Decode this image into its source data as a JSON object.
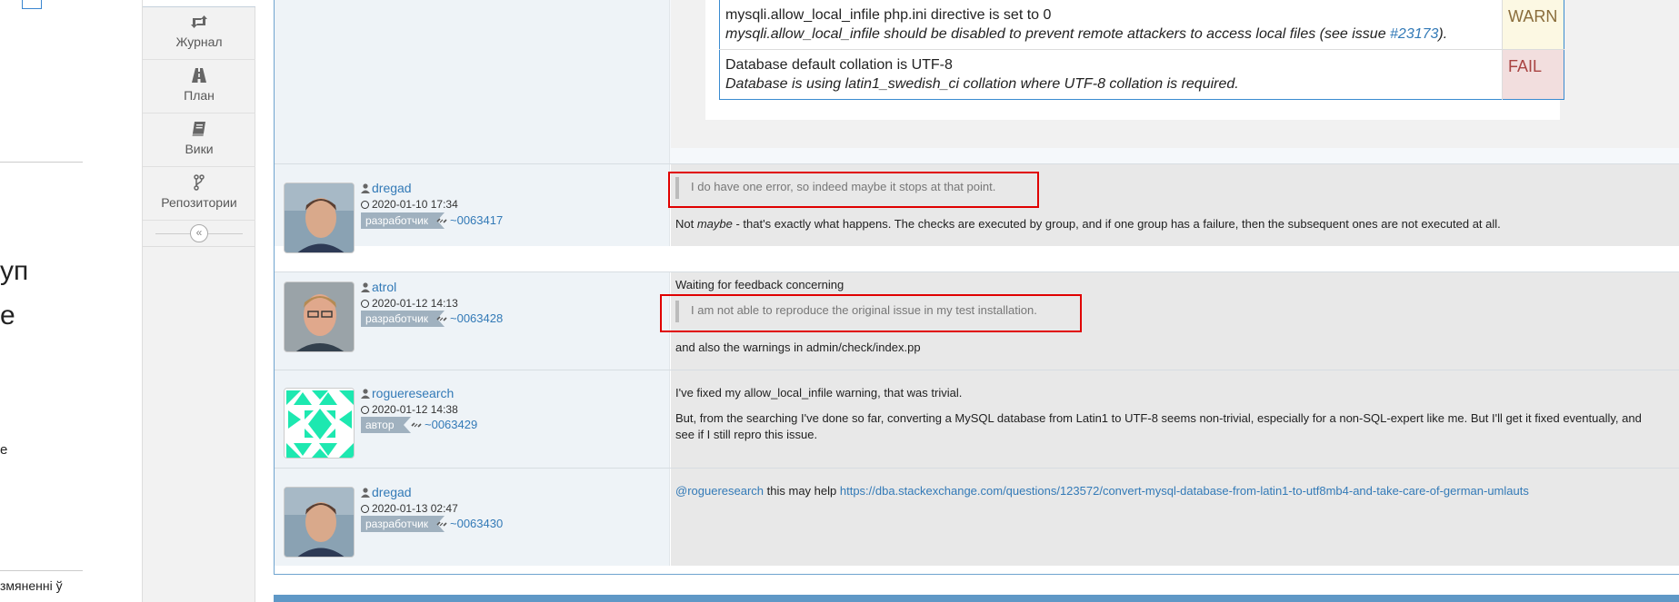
{
  "left_fragment": {
    "line1": "уп",
    "line2": "е",
    "line3": "е",
    "line4": "змяненні ў"
  },
  "side_menu": {
    "items": [
      {
        "label": "Журнал",
        "icon": "retweet-icon"
      },
      {
        "label": "План",
        "icon": "road-icon"
      },
      {
        "label": "Вики",
        "icon": "book-icon"
      },
      {
        "label": "Репозитории",
        "icon": "code-fork-icon"
      }
    ],
    "collapse_icon": "«"
  },
  "check_table": {
    "rows": [
      {
        "check": "mysqli.allow_local_infile php.ini directive is set to 0",
        "desc_prefix": "mysqli.allow_local_infile should be disabled to prevent remote attackers to access local files (see issue ",
        "desc_link": "#23173",
        "desc_suffix": ").",
        "status": "WARN"
      },
      {
        "check": "Database default collation is UTF-8",
        "desc": "Database is using latin1_swedish_ci collation where UTF-8 collation is required.",
        "status": "FAIL"
      }
    ]
  },
  "notes": [
    {
      "user": "dregad",
      "date": "2020-01-10 17:34",
      "role": "разработчик",
      "note_id": "~0063417",
      "quote": "I do have one error, so indeed maybe it stops at that point.",
      "text_pre": "Not ",
      "text_em": "maybe",
      "text_post": " - that's exactly what happens. The checks are executed by group, and if one group has a failure, then the subsequent ones are not executed at all."
    },
    {
      "user": "atrol",
      "date": "2020-01-12 14:13",
      "role": "разработчик",
      "note_id": "~0063428",
      "line1": "Waiting for feedback concerning",
      "quote": "I am not able to reproduce the original issue in my test installation.",
      "line2": "and also the warnings in admin/check/index.pp"
    },
    {
      "user": "rogueresearch",
      "date": "2020-01-12 14:38",
      "role": "автор",
      "note_id": "~0063429",
      "line1": "I've fixed my allow_local_infile warning, that was trivial.",
      "line2": "But, from the searching I've done so far, converting a MySQL database from Latin1 to UTF-8 seems non-trivial, especially for a non-SQL-expert like me. But I'll get it fixed eventually, and",
      "line3": "see if I still repro this issue."
    },
    {
      "user": "dregad",
      "date": "2020-01-13 02:47",
      "role": "разработчик",
      "note_id": "~0063430",
      "mention": "@rogueresearch",
      "text_mid": " this may help ",
      "url": "https://dba.stackexchange.com/questions/123572/convert-mysql-database-from-latin1-to-utf8mb4-and-take-care-of-german-umlauts"
    }
  ],
  "colors": {
    "link": "#337ab7",
    "highlight_box": "#e00000",
    "warn_bg": "#fcf8e3",
    "fail_bg": "#f2dede",
    "badge": "#a0b1bf"
  }
}
